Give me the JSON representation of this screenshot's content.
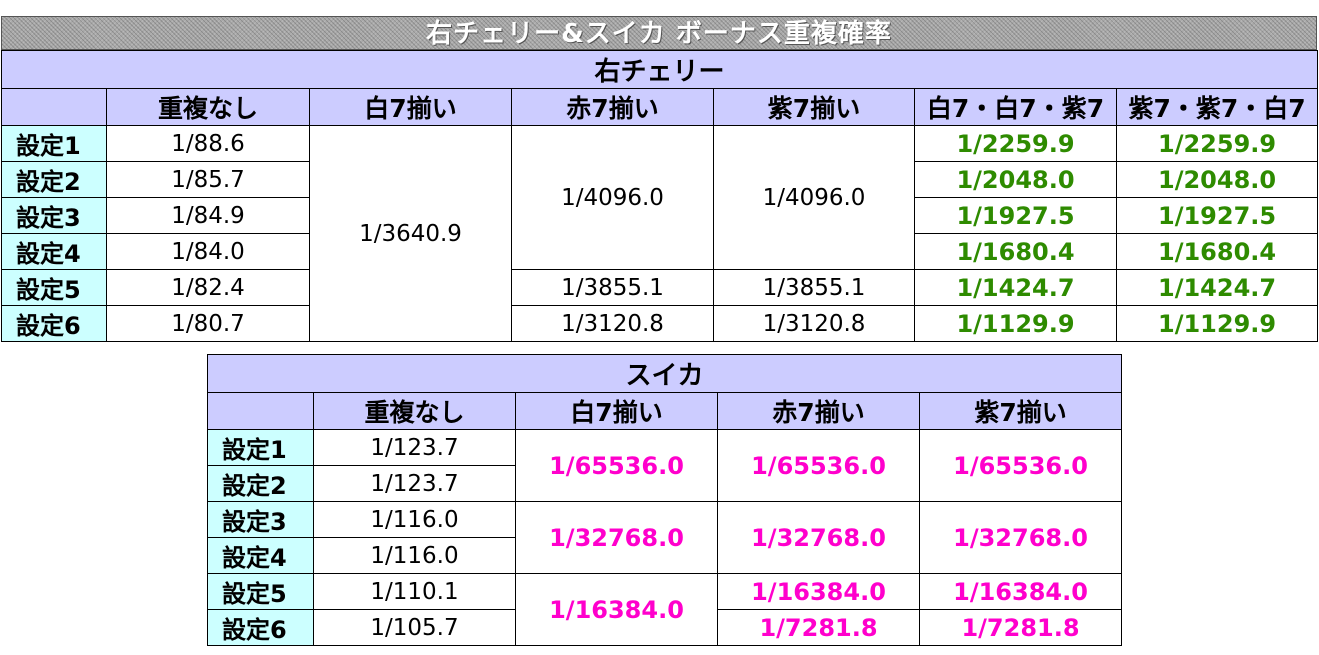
{
  "page_title": "右チェリー&スイカ ボーナス重複確率",
  "cherry": {
    "title": "右チェリー",
    "headers": [
      "重複なし",
      "白7揃い",
      "赤7揃い",
      "紫7揃い",
      "白7・白7・紫7",
      "紫7・紫7・白7"
    ],
    "settings": [
      "設定1",
      "設定2",
      "設定3",
      "設定4",
      "設定5",
      "設定6"
    ],
    "no_overlap": [
      "1/88.6",
      "1/85.7",
      "1/84.9",
      "1/84.0",
      "1/82.4",
      "1/80.7"
    ],
    "white7_all": "1/3640.9",
    "red7": [
      "1/4096.0",
      "1/3855.1",
      "1/3120.8"
    ],
    "purple7": [
      "1/4096.0",
      "1/3855.1",
      "1/3120.8"
    ],
    "wwp": [
      "1/2259.9",
      "1/2048.0",
      "1/1927.5",
      "1/1680.4",
      "1/1424.7",
      "1/1129.9"
    ],
    "ppw": [
      "1/2259.9",
      "1/2048.0",
      "1/1927.5",
      "1/1680.4",
      "1/1424.7",
      "1/1129.9"
    ]
  },
  "watermelon": {
    "title": "スイカ",
    "headers": [
      "重複なし",
      "白7揃い",
      "赤7揃い",
      "紫7揃い"
    ],
    "settings": [
      "設定1",
      "設定2",
      "設定3",
      "設定4",
      "設定5",
      "設定6"
    ],
    "no_overlap": [
      "1/123.7",
      "1/123.7",
      "1/116.0",
      "1/116.0",
      "1/110.1",
      "1/105.7"
    ],
    "white7": [
      "1/65536.0",
      "1/32768.0",
      "1/16384.0"
    ],
    "red7": [
      "1/65536.0",
      "1/32768.0",
      "1/16384.0",
      "1/7281.8"
    ],
    "purple7": [
      "1/65536.0",
      "1/32768.0",
      "1/16384.0",
      "1/7281.8"
    ]
  },
  "colors": {
    "header_bg": "#ccccff",
    "row_head_bg": "#ccffff",
    "green": "#2e8b00",
    "magenta": "#ff00cc"
  }
}
